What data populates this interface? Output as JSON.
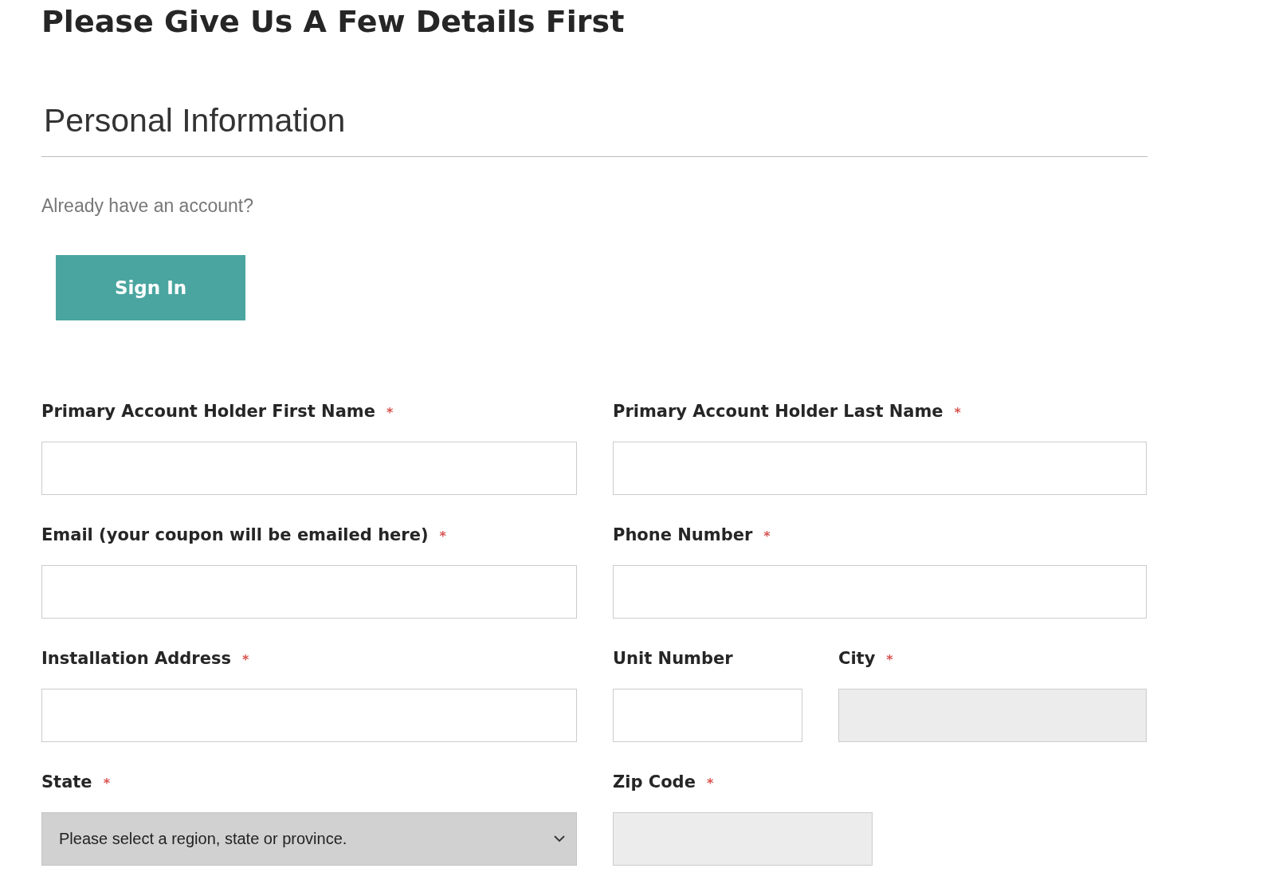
{
  "title": "Please Give Us A Few Details First",
  "section_title": "Personal Information",
  "signin_prompt": "Already have an account?",
  "sign_in_button": "Sign In",
  "fields": [
    {
      "label": "Primary Account Holder First Name",
      "required_mark": "*",
      "kind": "text",
      "disabled": false
    },
    {
      "label": "Primary Account Holder Last Name",
      "required_mark": "*",
      "kind": "text",
      "disabled": false
    },
    {
      "label": "Email (your coupon will be emailed here)",
      "required_mark": "*",
      "kind": "text",
      "disabled": false
    },
    {
      "label": "Phone Number",
      "required_mark": "*",
      "kind": "text",
      "disabled": false
    },
    {
      "label": "Installation Address",
      "required_mark": "*",
      "kind": "text",
      "disabled": false
    },
    {
      "label": "Unit Number",
      "kind": "text",
      "disabled": false
    },
    {
      "label": "City",
      "required_mark": "*",
      "kind": "text",
      "disabled": true
    },
    {
      "label": "State",
      "required_mark": "*",
      "kind": "select",
      "value": "Please select a region, state or province."
    },
    {
      "label": "Zip Code",
      "required_mark": "*",
      "kind": "text",
      "disabled": true
    }
  ]
}
